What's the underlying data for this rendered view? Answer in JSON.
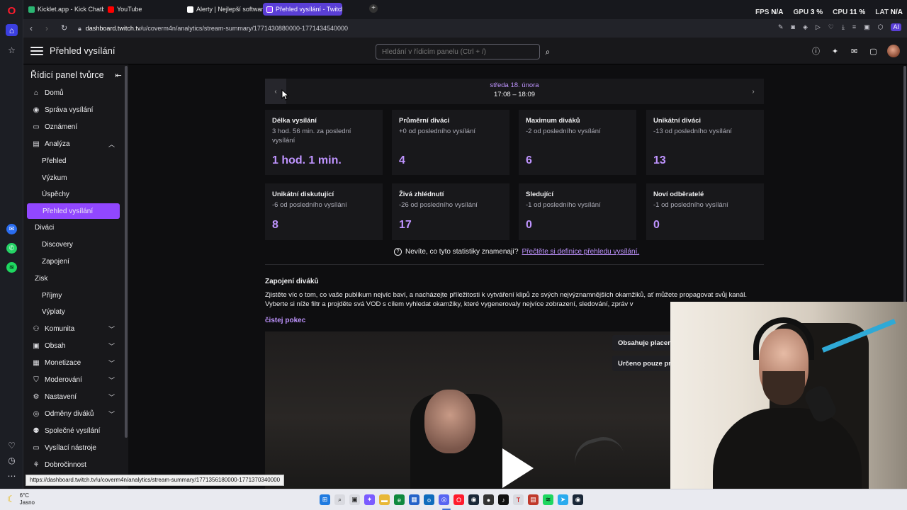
{
  "browser": {
    "tabs": [
      {
        "title": "Kicklet.app - Kick Chatbot",
        "color": "#2bb673"
      },
      {
        "title": "YouTube",
        "color": "#ff0000"
      },
      {
        "title": "Alerty | Nejlepší software p",
        "color": "#ffffff"
      },
      {
        "title": "Přehled vysílání - Twitch",
        "color": "#9147ff"
      }
    ],
    "perf": {
      "fps_label": "FPS",
      "fps": "N/A",
      "gpu_label": "GPU",
      "gpu": "3 %",
      "cpu_label": "CPU",
      "cpu": "11 %",
      "lat_label": "LAT",
      "lat": "N/A"
    },
    "url_host": "dashboard.twitch.tv",
    "url_path": "/u/coverm4n/analytics/stream-summary/1771430880000-1771434540000",
    "ai_label": "AI"
  },
  "topnav": {
    "title": "Přehled vysílání",
    "search_placeholder": "Hledání v řídicím panelu (Ctrl + /)"
  },
  "sidebar": {
    "header": "Řídicí panel tvůrce",
    "items": [
      {
        "label": "Domů",
        "icon": "home-icon"
      },
      {
        "label": "Správa vysílání",
        "icon": "broadcast-icon"
      },
      {
        "label": "Oznámení",
        "icon": "announcement-icon"
      },
      {
        "label": "Analýza",
        "icon": "analytics-icon"
      },
      {
        "label": "Přehled"
      },
      {
        "label": "Výzkum"
      },
      {
        "label": "Úspěchy"
      },
      {
        "label": "Přehled vysílání"
      },
      {
        "label": "Diváci"
      },
      {
        "label": "Discovery"
      },
      {
        "label": "Zapojení"
      },
      {
        "label": "Zisk"
      },
      {
        "label": "Příjmy"
      },
      {
        "label": "Výplaty"
      },
      {
        "label": "Komunita",
        "icon": "community-icon"
      },
      {
        "label": "Obsah",
        "icon": "content-icon"
      },
      {
        "label": "Monetizace",
        "icon": "monetization-icon"
      },
      {
        "label": "Moderování",
        "icon": "moderation-icon"
      },
      {
        "label": "Nastavení",
        "icon": "settings-icon"
      },
      {
        "label": "Odměny diváků",
        "icon": "rewards-icon"
      },
      {
        "label": "Společné vysílání",
        "icon": "collab-icon"
      },
      {
        "label": "Vysílací nástroje",
        "icon": "tools-icon"
      },
      {
        "label": "Dobročinnost",
        "icon": "charity-icon"
      }
    ]
  },
  "summary": {
    "day": "středa 18. února",
    "time": "17:08 – 18:09",
    "cards": [
      {
        "title": "Délka vysílání",
        "sub": "3 hod. 56 min. za poslední vysílání",
        "value": "1 hod. 1 min."
      },
      {
        "title": "Průměrní diváci",
        "sub": "+0 od posledního vysílání",
        "value": "4"
      },
      {
        "title": "Maximum diváků",
        "sub": "-2 od posledního vysílání",
        "value": "6"
      },
      {
        "title": "Unikátní diváci",
        "sub": "-13 od posledního vysílání",
        "value": "13"
      },
      {
        "title": "Unikátní diskutující",
        "sub": "-6 od posledního vysílání",
        "value": "8"
      },
      {
        "title": "Živá zhlédnutí",
        "sub": "-26 od posledního vysílání",
        "value": "17"
      },
      {
        "title": "Sledující",
        "sub": "-1 od posledního vysílání",
        "value": "0"
      },
      {
        "title": "Noví odběratelé",
        "sub": "-1 od posledního vysílání",
        "value": "0"
      }
    ],
    "help_text": "Nevíte, co tyto statistiky znamenají?",
    "help_link": "Přečtěte si definice přehledu vysílání."
  },
  "engagement": {
    "title": "Zapojení diváků",
    "text": "Zjistěte víc o tom, co vaše publikum nejvíc baví, a nacházejte příležitosti k vytváření klipů ze svých nejvýznamnějších okamžiků, ať můžete propagovat svůj kanál. Vyberte si níže filtr a projděte svá VOD s cílem vyhledat okamžiky, které vygenerovaly nejvíce zobrazení, sledování, zpráv v",
    "filter": "čistej pokec",
    "badge1": "Obsahuje placen",
    "badge2": "Určeno pouze pr"
  },
  "status_url": "https://dashboard.twitch.tv/u/coverm4n/analytics/stream-summary/1771356180000-1771370340000",
  "taskbar": {
    "temp": "6°C",
    "weather": "Jasno"
  }
}
